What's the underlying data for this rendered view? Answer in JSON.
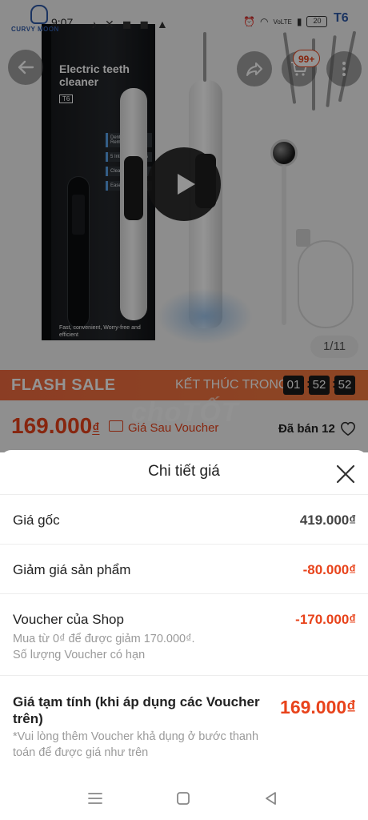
{
  "status_bar": {
    "time": "9:07",
    "battery": "20",
    "network": "VoLTE",
    "brand_watermark": "CURVY MOON",
    "model_watermark": "T6"
  },
  "header": {
    "cart_badge": "99+"
  },
  "product_image": {
    "box_title": "Electric teeth cleaner",
    "box_model": "T6",
    "box_features": [
      "Dental Plaque Remover",
      "5 Intensity Modes",
      "Clean Spikes",
      "Ease of Use"
    ],
    "box_slogan": "Fast, convenient, Worry-free and efficient",
    "counter": "1/11"
  },
  "flash_sale": {
    "title": "FLASH SALE",
    "ends_label": "KẾT THÚC TRONG",
    "hours": "01",
    "minutes": "52",
    "seconds": "52"
  },
  "price": {
    "amount": "169.000",
    "currency": "₫",
    "note": "Giá Sau Voucher",
    "sold": "Đã bán 12",
    "watermark": "choTỐT"
  },
  "sheet": {
    "title": "Chi tiết giá",
    "original_label": "Giá gốc",
    "original_value": "419.000₫",
    "discount_label": "Giảm giá sản phẩm",
    "discount_value": "-80.000₫",
    "voucher_label": "Voucher của Shop",
    "voucher_value": "-170.000₫",
    "voucher_sub_1": "Mua từ 0₫ để được giảm 170.000₫.",
    "voucher_sub_2": "Số lượng Voucher có hạn",
    "total_label": "Giá tạm tính (khi áp dụng các Voucher trên)",
    "total_value": "169.000₫",
    "total_note": "*Vui lòng thêm Voucher khả dụng ở bước thanh toán để được giá như trên"
  },
  "colors": {
    "accent": "#e8431b",
    "flash_bar": "#f06a3f",
    "text": "#222222",
    "muted": "#9a9a9a"
  },
  "icons": [
    "back-arrow-icon",
    "share-icon",
    "cart-icon",
    "more-icon",
    "play-icon",
    "heart-icon",
    "close-icon",
    "menu-icon",
    "home-icon",
    "back-triangle-icon"
  ]
}
